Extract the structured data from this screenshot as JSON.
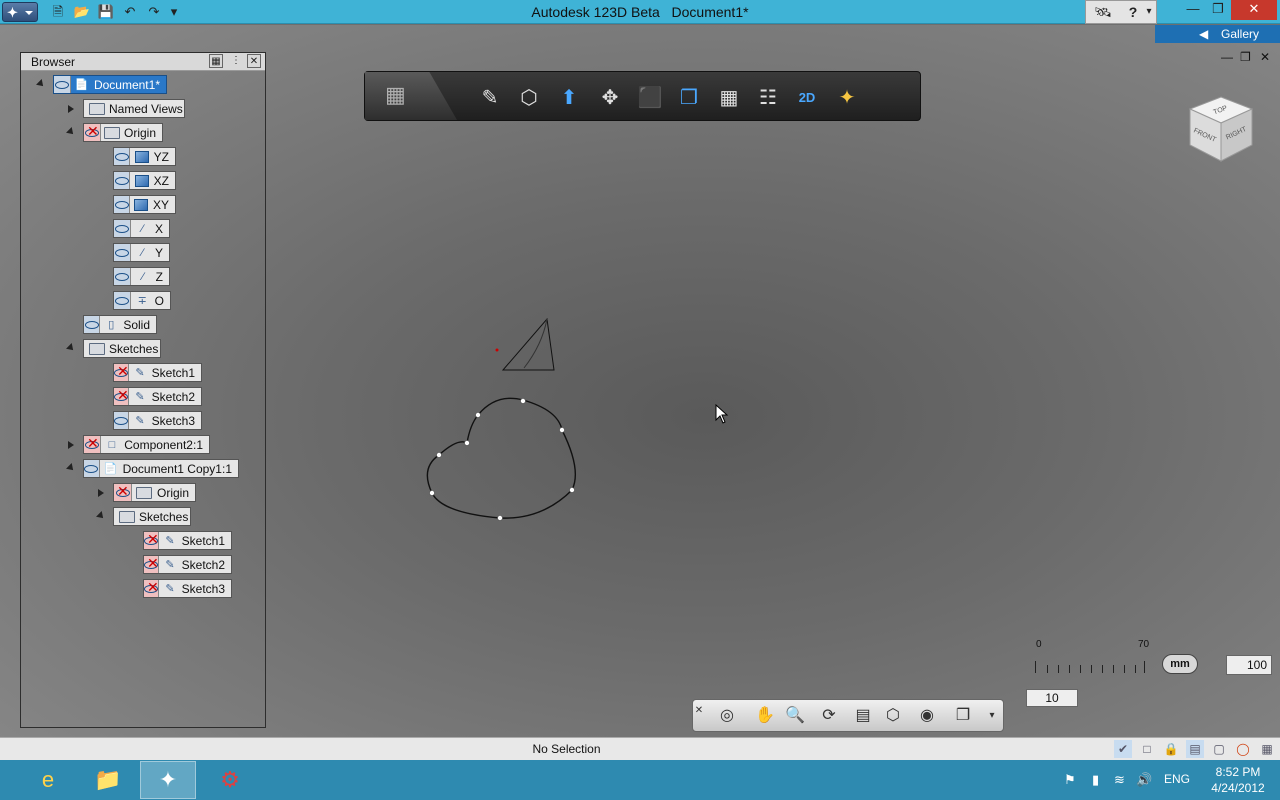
{
  "titlebar": {
    "app_title": "Autodesk 123D Beta",
    "doc_title": "Document1*"
  },
  "gallery": {
    "label": "Gallery"
  },
  "browser": {
    "title": "Browser",
    "nodes": [
      {
        "label": "Document1*"
      },
      {
        "label": "Named Views"
      },
      {
        "label": "Origin"
      },
      {
        "label": "YZ"
      },
      {
        "label": "XZ"
      },
      {
        "label": "XY"
      },
      {
        "label": "X"
      },
      {
        "label": "Y"
      },
      {
        "label": "Z"
      },
      {
        "label": "O"
      },
      {
        "label": "Solid"
      },
      {
        "label": "Sketches"
      },
      {
        "label": "Sketch1"
      },
      {
        "label": "Sketch2"
      },
      {
        "label": "Sketch3"
      },
      {
        "label": "Component2:1"
      },
      {
        "label": "Document1 Copy1:1"
      },
      {
        "label": "Origin"
      },
      {
        "label": "Sketches"
      },
      {
        "label": "Sketch1"
      },
      {
        "label": "Sketch2"
      },
      {
        "label": "Sketch3"
      }
    ]
  },
  "viewcube": {
    "top": "TOP",
    "front": "FRONT",
    "right": "RIGHT"
  },
  "scale": {
    "min": "0",
    "max": "70",
    "unit": "mm",
    "value_right": "100",
    "value_below": "10"
  },
  "toolbar": {
    "tool_2d_label": "2D"
  },
  "status": {
    "text": "No Selection"
  },
  "clock": {
    "time": "8:52 PM",
    "date": "4/24/2012",
    "lang": "ENG"
  }
}
